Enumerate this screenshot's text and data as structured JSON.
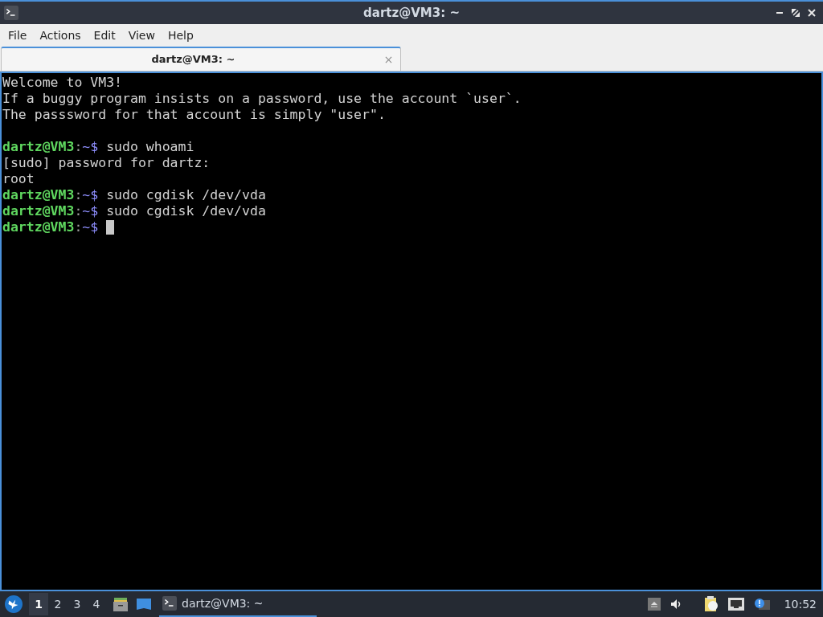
{
  "window": {
    "title": "dartz@VM3: ~"
  },
  "menu": [
    "File",
    "Actions",
    "Edit",
    "View",
    "Help"
  ],
  "tabs": [
    {
      "label": "dartz@VM3: ~",
      "selected": true
    }
  ],
  "terminal": {
    "lines": [
      {
        "kind": "output",
        "text": "Welcome to VM3!"
      },
      {
        "kind": "output",
        "text": "If a buggy program insists on a password, use the account `user`."
      },
      {
        "kind": "output",
        "text": "The passsword for that account is simply \"user\"."
      },
      {
        "kind": "blank"
      },
      {
        "kind": "prompt",
        "user": "dartz@VM3",
        "separator": ":",
        "path": "~$",
        "command": "sudo whoami",
        "cursor": false
      },
      {
        "kind": "output",
        "text": "[sudo] password for dartz:"
      },
      {
        "kind": "output",
        "text": "root"
      },
      {
        "kind": "prompt",
        "user": "dartz@VM3",
        "separator": ":",
        "path": "~$",
        "command": "sudo cgdisk /dev/vda",
        "cursor": false
      },
      {
        "kind": "prompt",
        "user": "dartz@VM3",
        "separator": ":",
        "path": "~$",
        "command": "sudo cgdisk /dev/vda",
        "cursor": false
      },
      {
        "kind": "prompt",
        "user": "dartz@VM3",
        "separator": ":",
        "path": "~$",
        "cursor": true
      }
    ]
  },
  "taskbar": {
    "workspaces": [
      {
        "label": "1",
        "selected": true
      },
      {
        "label": "2",
        "selected": false
      },
      {
        "label": "3",
        "selected": false
      },
      {
        "label": "4",
        "selected": false
      }
    ],
    "tasks": [
      {
        "label": "dartz@VM3: ~",
        "selected": true
      }
    ],
    "clock": "10:52"
  }
}
